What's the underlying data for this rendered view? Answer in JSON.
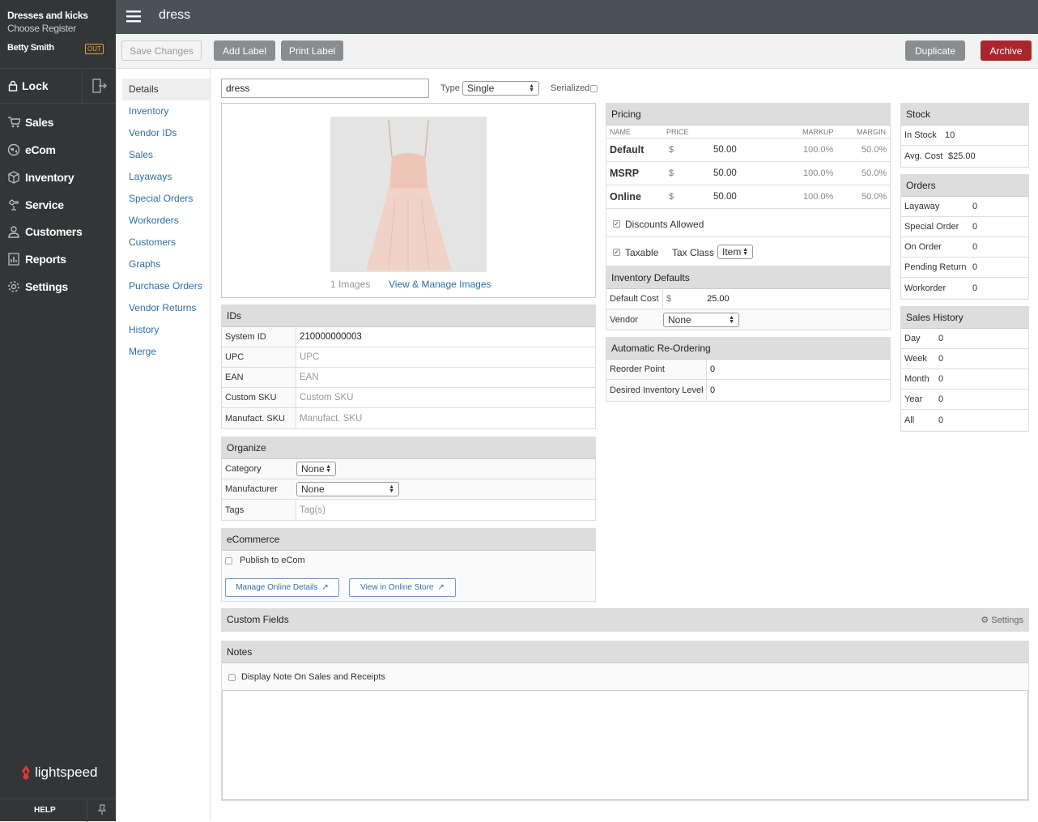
{
  "sidebar": {
    "shop": "Dresses and kicks",
    "register": "Choose Register",
    "user": "Betty Smith",
    "status": "OUT",
    "lock": "Lock",
    "items": [
      {
        "label": "Sales",
        "icon": "cart-icon"
      },
      {
        "label": "eCom",
        "icon": "globe-icon"
      },
      {
        "label": "Inventory",
        "icon": "box-icon"
      },
      {
        "label": "Service",
        "icon": "wrench-icon"
      },
      {
        "label": "Customers",
        "icon": "person-icon"
      },
      {
        "label": "Reports",
        "icon": "report-icon"
      },
      {
        "label": "Settings",
        "icon": "gear-icon"
      }
    ],
    "logo": "lightspeed",
    "help": "HELP"
  },
  "header": {
    "title": "dress"
  },
  "toolbar": {
    "save": "Save Changes",
    "add_label": "Add Label",
    "print_label": "Print Label",
    "duplicate": "Duplicate",
    "archive": "Archive"
  },
  "subnav": [
    "Details",
    "Inventory",
    "Vendor IDs",
    "Sales",
    "Layaways",
    "Special Orders",
    "Workorders",
    "Customers",
    "Graphs",
    "Purchase Orders",
    "Vendor Returns",
    "History",
    "Merge"
  ],
  "item": {
    "name": "dress",
    "type_label": "Type",
    "type": "Single",
    "serialized_label": "Serialized",
    "image_count": "1 Images",
    "manage_images": "View & Manage Images"
  },
  "ids": {
    "title": "IDs",
    "rows": [
      {
        "k": "System ID",
        "v": "210000000003"
      },
      {
        "k": "UPC",
        "v": "UPC"
      },
      {
        "k": "EAN",
        "v": "EAN"
      },
      {
        "k": "Custom SKU",
        "v": "Custom SKU"
      },
      {
        "k": "Manufact. SKU",
        "v": "Manufact. SKU"
      }
    ]
  },
  "organize": {
    "title": "Organize",
    "category_label": "Category",
    "category": "None",
    "manufacturer_label": "Manufacturer",
    "manufacturer": "None",
    "tags_label": "Tags",
    "tags_placeholder": "Tag(s)"
  },
  "ecommerce": {
    "title": "eCommerce",
    "publish": "Publish to eCom",
    "manage": "Manage Online Details",
    "view": "View in Online Store"
  },
  "pricing": {
    "title": "Pricing",
    "headers": [
      "NAME",
      "PRICE",
      "MARKUP",
      "MARGIN"
    ],
    "rows": [
      {
        "name": "Default",
        "cur": "$",
        "price": "50.00",
        "markup": "100.0%",
        "margin": "50.0%"
      },
      {
        "name": "MSRP",
        "cur": "$",
        "price": "50.00",
        "markup": "100.0%",
        "margin": "50.0%"
      },
      {
        "name": "Online",
        "cur": "$",
        "price": "50.00",
        "markup": "100.0%",
        "margin": "50.0%"
      }
    ],
    "discounts": "Discounts Allowed",
    "taxable": "Taxable",
    "tax_class_label": "Tax Class",
    "tax_class": "Item"
  },
  "inv_defaults": {
    "title": "Inventory Defaults",
    "cost_label": "Default Cost",
    "cur": "$",
    "cost": "25.00",
    "vendor_label": "Vendor",
    "vendor": "None"
  },
  "reorder": {
    "title": "Automatic Re-Ordering",
    "point_label": "Reorder Point",
    "point": "0",
    "level_label": "Desired Inventory Level",
    "level": "0"
  },
  "stock": {
    "title": "Stock",
    "in_stock_label": "In Stock",
    "in_stock": "10",
    "avg_cost_label": "Avg. Cost",
    "avg_cost": "$25.00"
  },
  "orders": {
    "title": "Orders",
    "rows": [
      {
        "k": "Layaway",
        "v": "0"
      },
      {
        "k": "Special Order",
        "v": "0"
      },
      {
        "k": "On Order",
        "v": "0"
      },
      {
        "k": "Pending Return",
        "v": "0"
      },
      {
        "k": "Workorder",
        "v": "0"
      }
    ]
  },
  "sales_history": {
    "title": "Sales History",
    "rows": [
      {
        "k": "Day",
        "v": "0"
      },
      {
        "k": "Week",
        "v": "0"
      },
      {
        "k": "Month",
        "v": "0"
      },
      {
        "k": "Year",
        "v": "0"
      },
      {
        "k": "All",
        "v": "0"
      }
    ]
  },
  "custom_fields": {
    "title": "Custom Fields",
    "settings": "Settings"
  },
  "notes": {
    "title": "Notes",
    "display": "Display Note On Sales and Receipts"
  }
}
